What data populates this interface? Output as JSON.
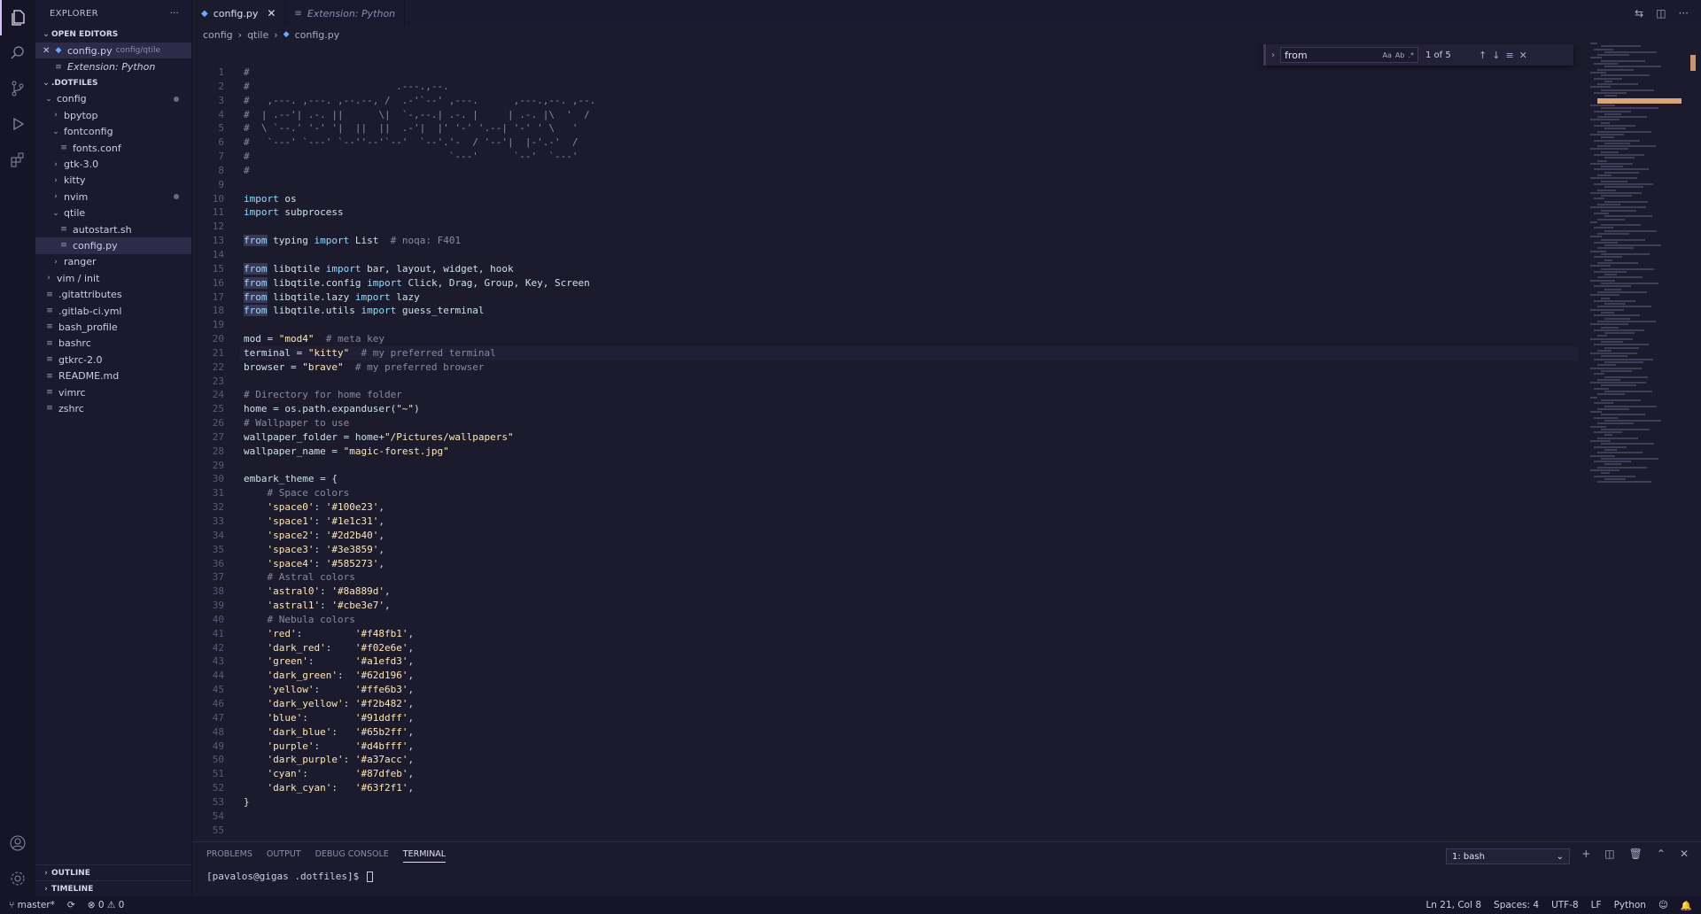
{
  "activity": {
    "icons": [
      "explorer-icon",
      "search-icon",
      "source-control-icon",
      "run-debug-icon",
      "extensions-icon"
    ],
    "bottom_icons": [
      "account-icon",
      "settings-icon"
    ]
  },
  "sidebar": {
    "title": "EXPLORER",
    "open_editors_title": "OPEN EDITORS",
    "open_editors": [
      {
        "name": "config.py",
        "path": "config/qtile"
      },
      {
        "name": "Extension: Python",
        "path": ""
      }
    ],
    "root_title": ".DOTFILES",
    "tree": [
      {
        "label": "config",
        "kind": "folder-open",
        "depth": 0
      },
      {
        "label": "bpytop",
        "kind": "folder",
        "depth": 1
      },
      {
        "label": "fontconfig",
        "kind": "folder-open",
        "depth": 1
      },
      {
        "label": "fonts.conf",
        "kind": "file",
        "depth": 2
      },
      {
        "label": "gtk-3.0",
        "kind": "folder",
        "depth": 1
      },
      {
        "label": "kitty",
        "kind": "folder",
        "depth": 1
      },
      {
        "label": "nvim",
        "kind": "folder",
        "depth": 1
      },
      {
        "label": "qtile",
        "kind": "folder-open",
        "depth": 1
      },
      {
        "label": "autostart.sh",
        "kind": "file",
        "depth": 2
      },
      {
        "label": "config.py",
        "kind": "file",
        "depth": 2
      },
      {
        "label": "ranger",
        "kind": "folder",
        "depth": 1
      },
      {
        "label": "vim / init",
        "kind": "folder",
        "depth": 0
      },
      {
        "label": ".gitattributes",
        "kind": "file",
        "depth": 0
      },
      {
        "label": ".gitlab-ci.yml",
        "kind": "file",
        "depth": 0
      },
      {
        "label": "bash_profile",
        "kind": "file",
        "depth": 0
      },
      {
        "label": "bashrc",
        "kind": "file",
        "depth": 0
      },
      {
        "label": "gtkrc-2.0",
        "kind": "file",
        "depth": 0
      },
      {
        "label": "README.md",
        "kind": "file",
        "depth": 0
      },
      {
        "label": "vimrc",
        "kind": "file",
        "depth": 0
      },
      {
        "label": "zshrc",
        "kind": "file",
        "depth": 0
      }
    ],
    "outline_title": "OUTLINE",
    "timeline_title": "TIMELINE"
  },
  "tabs": [
    {
      "label": "config.py",
      "active": true
    },
    {
      "label": "Extension: Python",
      "active": false
    }
  ],
  "breadcrumb": [
    "config",
    "qtile",
    "config.py"
  ],
  "find": {
    "query": "from",
    "count": "1 of 5",
    "options": [
      "Aa",
      "Ab",
      ".*"
    ]
  },
  "editor": {
    "lines": [
      "#",
      "#                         .---.,--.",
      "#   ,---. ,---. ,--.--, /  .-'`--' ,---.      ,---.,--. ,--.",
      "#  | .--'| .-. ||      \\|  `-,--.| .-. |     | .-. |\\  '  /",
      "#  \\ `--.' '-' '|  ||  ||  .-'|  |' '-' '.--| '-' ' \\   '",
      "#   `---' `---' `--''--'`--'  `--'.'-  / '--'|  |-'.-'  /",
      "#                                  `---'      `--'  `---'",
      "#",
      "",
      "import os",
      "import subprocess",
      "",
      "from typing import List  # noqa: F401",
      "",
      "from libqtile import bar, layout, widget, hook",
      "from libqtile.config import Click, Drag, Group, Key, Screen",
      "from libqtile.lazy import lazy",
      "from libqtile.utils import guess_terminal",
      "",
      "mod = \"mod4\"  # meta key",
      "terminal = \"kitty\"  # my preferred terminal",
      "browser = \"brave\"  # my preferred browser",
      "",
      "# Directory for home folder",
      "home = os.path.expanduser(\"~\")",
      "# Wallpaper to use",
      "wallpaper_folder = home+\"/Pictures/wallpapers\"",
      "wallpaper_name = \"magic-forest.jpg\"",
      "",
      "embark_theme = {",
      "    # Space colors",
      "    'space0': '#100e23',",
      "    'space1': '#1e1c31',",
      "    'space2': '#2d2b40',",
      "    'space3': '#3e3859',",
      "    'space4': '#585273',",
      "    # Astral colors",
      "    'astral0': '#8a889d',",
      "    'astral1': '#cbe3e7',",
      "    # Nebula colors",
      "    'red':         '#f48fb1',",
      "    'dark_red':    '#f02e6e',",
      "    'green':       '#a1efd3',",
      "    'dark_green':  '#62d196',",
      "    'yellow':      '#ffe6b3',",
      "    'dark_yellow': '#f2b482',",
      "    'blue':        '#91ddff',",
      "    'dark_blue':   '#65b2ff',",
      "    'purple':      '#d4bfff',",
      "    'dark_purple': '#a37acc',",
      "    'cyan':        '#87dfeb',",
      "    'dark_cyan':   '#63f2f1',",
      "}",
      "",
      ""
    ],
    "current_line": 21
  },
  "panel": {
    "tabs": [
      "PROBLEMS",
      "OUTPUT",
      "DEBUG CONSOLE",
      "TERMINAL"
    ],
    "active_tab": "TERMINAL",
    "terminal_select": "1: bash",
    "prompt": "[pavalos@gigas .dotfiles]$ "
  },
  "status": {
    "branch": "master*",
    "problems": "⊗ 0 ⚠ 0",
    "position": "Ln 21, Col 8",
    "spaces": "Spaces: 4",
    "encoding": "UTF-8",
    "eol": "LF",
    "language": "Python"
  },
  "colors": {
    "accent": "#d4bfff",
    "keyword": "#91ddff",
    "string": "#ffe6b3",
    "comment": "#8a889d",
    "background": "#1c1b2e"
  }
}
